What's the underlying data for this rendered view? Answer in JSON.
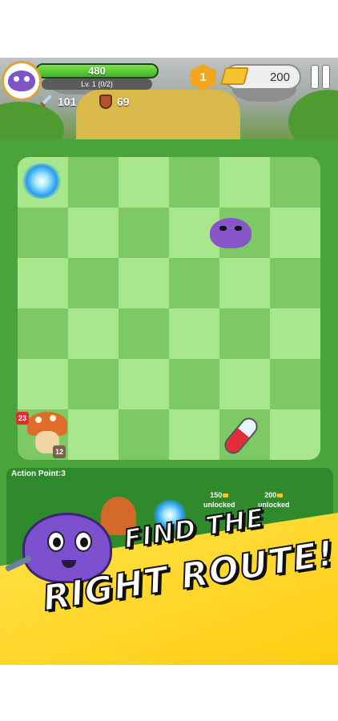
{
  "hud": {
    "hp_value": "480",
    "hp_fraction": 1.0,
    "level_text": "Lv. 1 (0/2)",
    "attack": "101",
    "defense": "69",
    "stage_level": "1",
    "gold": "200",
    "icons": {
      "avatar": "purple-slime-avatar",
      "attack": "sword-icon",
      "defense": "shield-icon",
      "gold": "gold-bar-icon",
      "pause": "pause-icon"
    }
  },
  "board": {
    "rows": 6,
    "cols": 6,
    "colors": {
      "light": "#a8e78e",
      "dark": "#7dc966",
      "frame": "#4aa33b"
    },
    "pieces": [
      {
        "type": "portal",
        "row": 0,
        "col": 0
      },
      {
        "type": "purple-slime",
        "row": 1,
        "col": 4
      },
      {
        "type": "mushroom",
        "row": 5,
        "col": 0,
        "attack": "23",
        "defense": "12"
      },
      {
        "type": "health-potion",
        "row": 5,
        "col": 4
      }
    ]
  },
  "action": {
    "label": "Action Point:3",
    "slots": [
      {
        "cost": "150",
        "status": "unlocked"
      },
      {
        "cost": "200",
        "status": "unlocked"
      }
    ]
  },
  "promo": {
    "line1": "FIND THE",
    "line2": "RIGHT ROUTE!"
  }
}
